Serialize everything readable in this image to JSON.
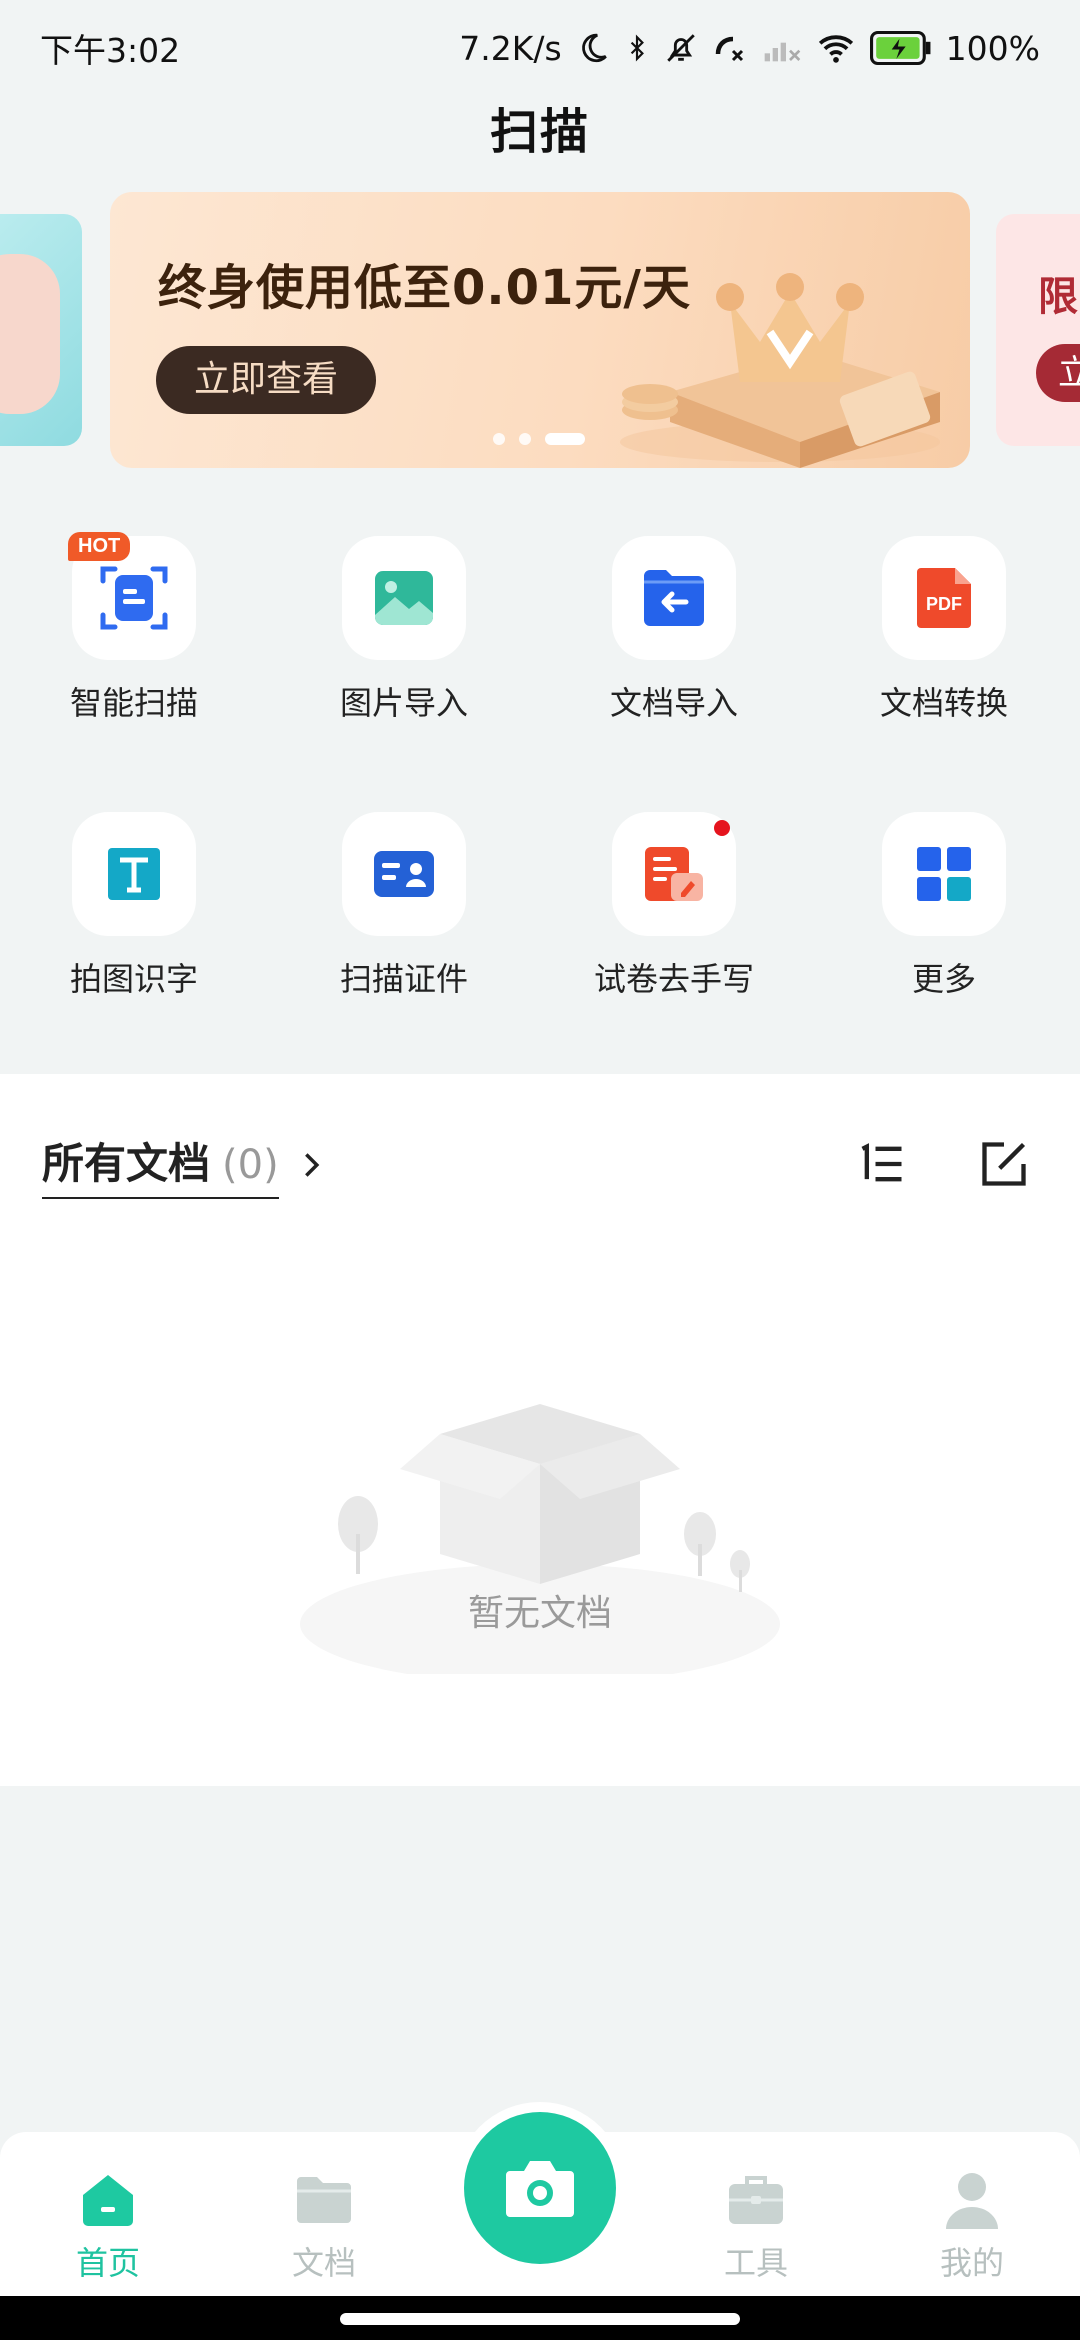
{
  "status_bar": {
    "time": "下午3:02",
    "network_speed": "7.2K/s",
    "battery": "100%",
    "icons": [
      "moon-icon",
      "bluetooth-icon",
      "mute-bell-icon",
      "call-icon",
      "signal-icon",
      "wifi-icon",
      "battery-icon"
    ]
  },
  "header": {
    "title": "扫描"
  },
  "banner": {
    "headline": "终身使用低至0.01元/天",
    "button_label": "立即查看",
    "next_preview_text": "限",
    "next_preview_button": "立",
    "slide_count": 3,
    "active_slide": 3
  },
  "features": [
    {
      "label": "智能扫描",
      "icon": "smart-scan-icon",
      "badge": "HOT"
    },
    {
      "label": "图片导入",
      "icon": "image-import-icon"
    },
    {
      "label": "文档导入",
      "icon": "document-import-icon"
    },
    {
      "label": "文档转换",
      "icon": "pdf-convert-icon"
    },
    {
      "label": "拍图识字",
      "icon": "text-recognition-icon"
    },
    {
      "label": "扫描证件",
      "icon": "id-scan-icon"
    },
    {
      "label": "试卷去手写",
      "icon": "erase-handwriting-icon",
      "dot": true
    },
    {
      "label": "更多",
      "icon": "more-grid-icon"
    }
  ],
  "documents": {
    "title": "所有文档",
    "count": "(0)",
    "empty_text": "暂无文档"
  },
  "bottom_nav": {
    "items": [
      {
        "label": "首页",
        "icon": "home-icon",
        "active": true
      },
      {
        "label": "文档",
        "icon": "folder-icon"
      },
      {
        "label": "工具",
        "icon": "toolbox-icon"
      },
      {
        "label": "我的",
        "icon": "profile-icon"
      }
    ]
  },
  "colors": {
    "accent": "#1ec9a1",
    "nav_inactive": "#b7c0bf",
    "background": "#f1f4f4",
    "banner_text": "#3c220d",
    "hot_badge": "#f05a28"
  }
}
